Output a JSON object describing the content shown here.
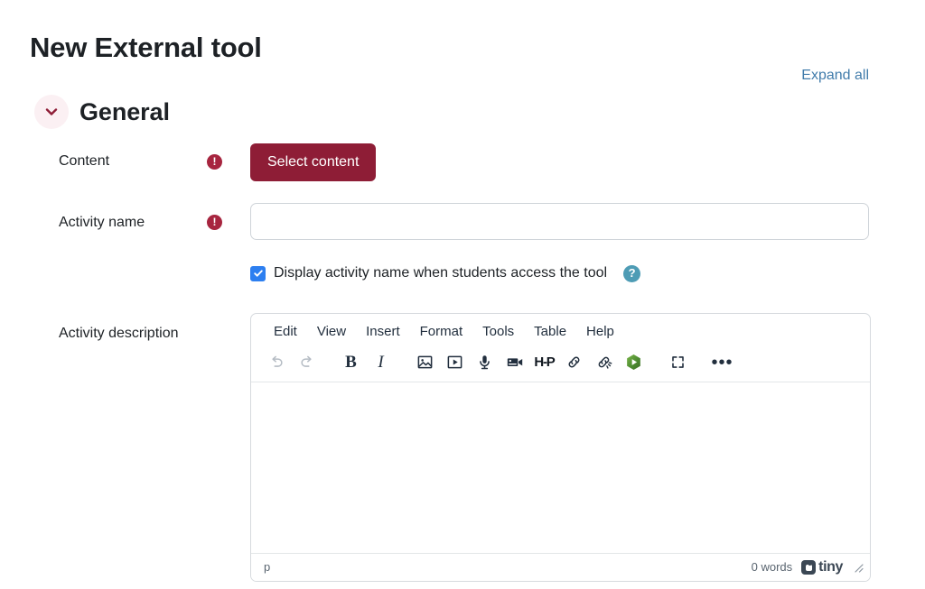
{
  "page": {
    "title": "New External tool"
  },
  "actions": {
    "expand_all": "Expand all"
  },
  "section": {
    "title": "General",
    "collapse_icon": "chevron-down-icon"
  },
  "fields": {
    "content": {
      "label": "Content",
      "required_marker": "!",
      "button_label": "Select content"
    },
    "activity_name": {
      "label": "Activity name",
      "required_marker": "!",
      "value": "",
      "placeholder": ""
    },
    "display_name_checkbox": {
      "label": "Display activity name when students access the tool",
      "checked": true,
      "help_marker": "?"
    },
    "activity_description": {
      "label": "Activity description"
    }
  },
  "editor": {
    "menubar": [
      {
        "label": "Edit"
      },
      {
        "label": "View"
      },
      {
        "label": "Insert"
      },
      {
        "label": "Format"
      },
      {
        "label": "Tools"
      },
      {
        "label": "Table"
      },
      {
        "label": "Help"
      }
    ],
    "toolbar": [
      {
        "name": "undo-icon",
        "title": "Undo",
        "disabled": true
      },
      {
        "name": "redo-icon",
        "title": "Redo",
        "disabled": true
      },
      {
        "name": "bold-icon",
        "title": "Bold",
        "glyph": "B"
      },
      {
        "name": "italic-icon",
        "title": "Italic",
        "glyph": "I"
      },
      {
        "name": "image-icon",
        "title": "Image"
      },
      {
        "name": "media-icon",
        "title": "Media"
      },
      {
        "name": "microphone-icon",
        "title": "Record audio"
      },
      {
        "name": "video-camera-icon",
        "title": "Record video"
      },
      {
        "name": "h5p-icon",
        "title": "H5P",
        "glyph": "H-P"
      },
      {
        "name": "link-icon",
        "title": "Insert link"
      },
      {
        "name": "unlink-icon",
        "title": "Remove link"
      },
      {
        "name": "kaltura-media-icon",
        "title": "Kaltura media"
      },
      {
        "name": "fullscreen-icon",
        "title": "Fullscreen"
      },
      {
        "name": "more-icon",
        "title": "More"
      }
    ],
    "body_content": "",
    "status": {
      "path": "p",
      "word_count": "0 words",
      "brand": "tiny"
    }
  },
  "colors": {
    "brand_maroon": "#8e1d36",
    "required_red": "#a7253f",
    "link_blue": "#417cab",
    "checkbox_blue": "#2d7ff0",
    "help_teal": "#4e9cb5",
    "kaltura_green": "#5a9e3a"
  }
}
